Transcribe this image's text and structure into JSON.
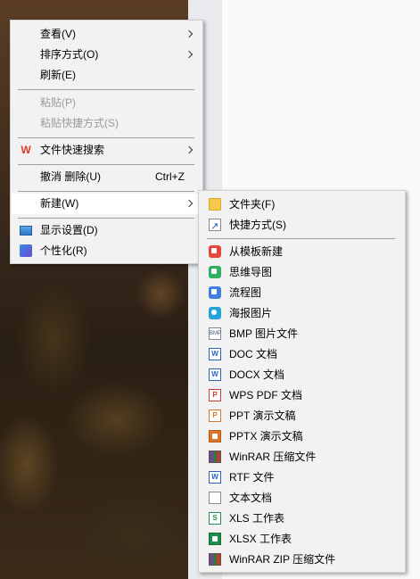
{
  "context_menu": {
    "view": "查看(V)",
    "sort": "排序方式(O)",
    "refresh": "刷新(E)",
    "paste": "粘贴(P)",
    "paste_shortcut": "粘贴快捷方式(S)",
    "wps_search": "文件快速搜索",
    "undo": "撤消 删除(U)",
    "undo_accel": "Ctrl+Z",
    "new": "新建(W)",
    "display": "显示设置(D)",
    "personalize": "个性化(R)"
  },
  "new_submenu": {
    "folder": "文件夹(F)",
    "shortcut": "快捷方式(S)",
    "from_template": "从模板新建",
    "mindmap": "思维导图",
    "flowchart": "流程图",
    "poster": "海报图片",
    "bmp": "BMP 图片文件",
    "doc": "DOC 文档",
    "docx": "DOCX 文档",
    "wps_pdf": "WPS PDF 文档",
    "ppt": "PPT 演示文稿",
    "pptx": "PPTX 演示文稿",
    "winrar": "WinRAR 压缩文件",
    "rtf": "RTF 文件",
    "text": "文本文档",
    "xls": "XLS 工作表",
    "xlsx": "XLSX 工作表",
    "winrar_zip": "WinRAR ZIP 压缩文件"
  },
  "icons": {
    "wps": "W",
    "bmp": "BMP",
    "doc": "W",
    "pdf": "P",
    "ppt": "P",
    "xls": "S"
  },
  "colors": {
    "menu_bg": "#f2f2f2",
    "hover_bg": "#ffffff",
    "disabled_text": "#9a9a9a",
    "wps_red": "#e4382a"
  }
}
